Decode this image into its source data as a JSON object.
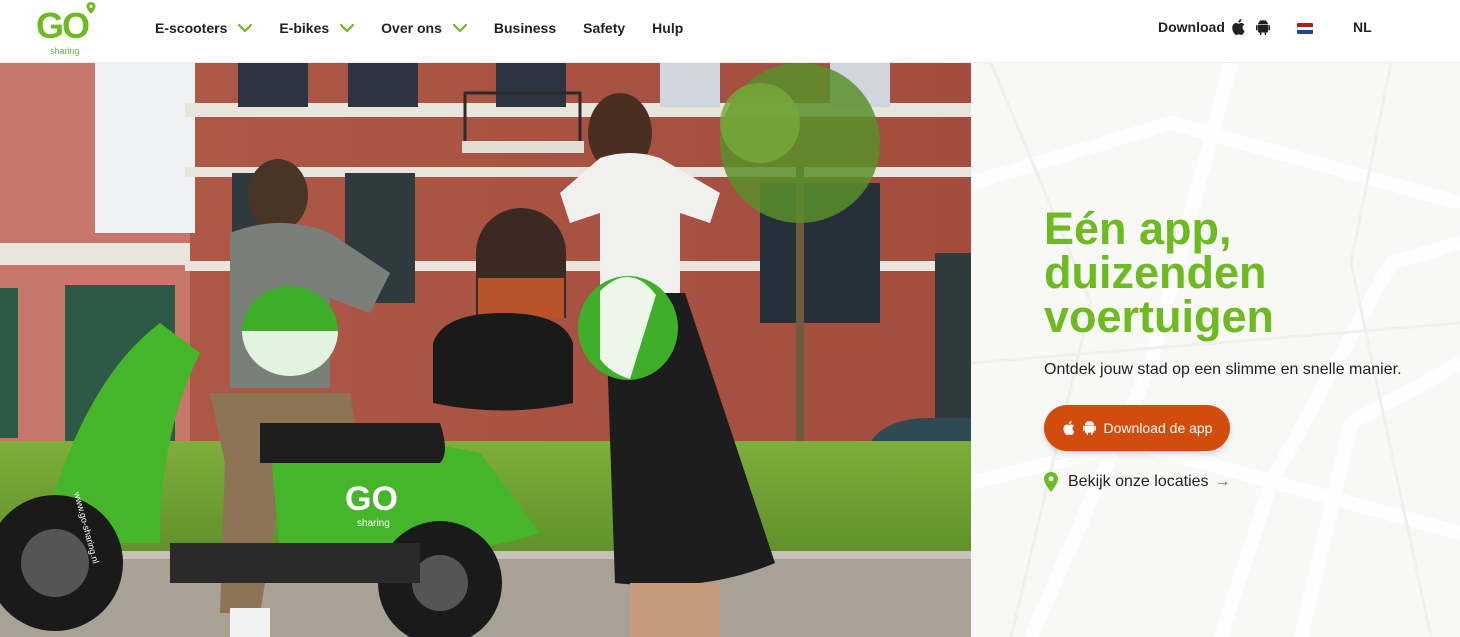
{
  "brand": {
    "logo_text": "GO",
    "logo_sub": "sharing",
    "accent": "#6dbb1f",
    "cta_color": "#d24d0d"
  },
  "nav": {
    "items": [
      {
        "label": "E-scooters",
        "has_dropdown": true
      },
      {
        "label": "E-bikes",
        "has_dropdown": true
      },
      {
        "label": "Over ons",
        "has_dropdown": true
      },
      {
        "label": "Business",
        "has_dropdown": false
      },
      {
        "label": "Safety",
        "has_dropdown": false
      },
      {
        "label": "Hulp",
        "has_dropdown": false
      }
    ],
    "download_label": "Download",
    "language": "NL"
  },
  "hero": {
    "headline_lines": [
      "Eén app,",
      "duizenden",
      "voertuigen"
    ],
    "tagline": "Ontdek jouw stad op een slimme en snelle manier.",
    "cta_label": "Download de app",
    "locations_label": "Bekijk onze locaties",
    "locations_arrow": "→",
    "scooter_logo": "GO",
    "scooter_sub": "sharing",
    "scooter_url": "www.go-sharing.nl"
  }
}
